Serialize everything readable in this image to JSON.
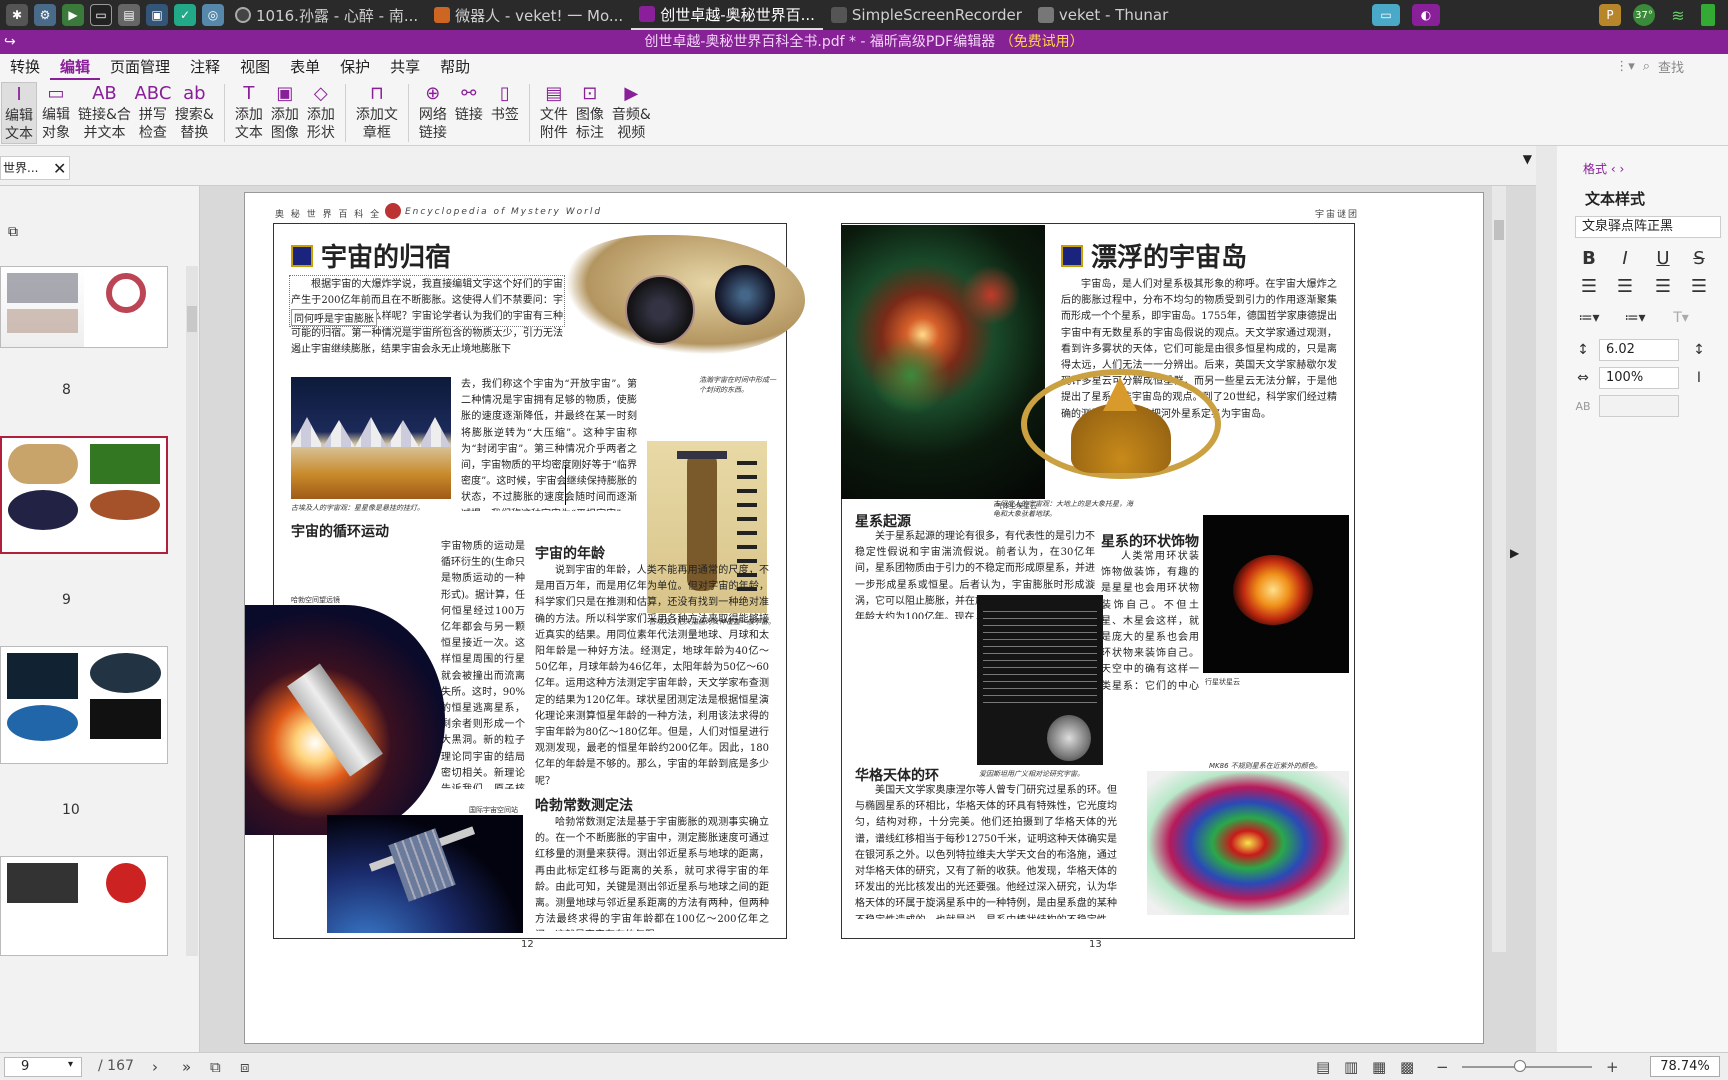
{
  "taskbar": {
    "windows": [
      {
        "label": "1016.孙露 - 心醉 - 南...",
        "active": false
      },
      {
        "label": "微器人 - veket! 一 Mo...",
        "active": false
      },
      {
        "label": "创世卓越-奥秘世界百...",
        "active": true
      },
      {
        "label": "SimpleScreenRecorder",
        "active": false
      },
      {
        "label": "veket - Thunar",
        "active": false
      }
    ],
    "temperature": "37°"
  },
  "titlebar": {
    "title": "创世卓越-奥秘世界百科全书.pdf * - 福昕高级PDF编辑器",
    "trial": "（免费试用）"
  },
  "menu": {
    "items": [
      "转换",
      "编辑",
      "页面管理",
      "注释",
      "视图",
      "表单",
      "保护",
      "共享",
      "帮助"
    ],
    "search_placeholder": "查找"
  },
  "ribbon": {
    "groups": [
      [
        {
          "label": "编辑\n文本",
          "icon": "edit-text-icon",
          "glyph": "I",
          "active": true
        },
        {
          "label": "编辑\n对象",
          "icon": "edit-object-icon",
          "glyph": "▭"
        },
        {
          "label": "链接&合\n并文本",
          "icon": "link-merge-icon",
          "glyph": "AB"
        },
        {
          "label": "拼写\n检查",
          "icon": "spell-check-icon",
          "glyph": "ABC"
        },
        {
          "label": "搜索&\n替换",
          "icon": "search-replace-icon",
          "glyph": "ab"
        }
      ],
      [
        {
          "label": "添加\n文本",
          "icon": "add-text-icon",
          "glyph": "T"
        },
        {
          "label": "添加\n图像",
          "icon": "add-image-icon",
          "glyph": "▣"
        },
        {
          "label": "添加\n形状",
          "icon": "add-shape-icon",
          "glyph": "◇"
        }
      ],
      [
        {
          "label": "添加文\n章框",
          "icon": "article-box-icon",
          "glyph": "⊓"
        }
      ],
      [
        {
          "label": "网络\n链接",
          "icon": "web-link-icon",
          "glyph": "⊕"
        },
        {
          "label": "链接",
          "icon": "link-icon",
          "glyph": "⚯"
        },
        {
          "label": "书签",
          "icon": "bookmark-icon",
          "glyph": "▯"
        }
      ],
      [
        {
          "label": "文件\n附件",
          "icon": "file-attachment-icon",
          "glyph": "▤"
        },
        {
          "label": "图像\n标注",
          "icon": "image-annotation-icon",
          "glyph": "⊡"
        },
        {
          "label": "音频&\n视频",
          "icon": "audio-video-icon",
          "glyph": "▶"
        }
      ]
    ]
  },
  "doctab": {
    "label": "世界..."
  },
  "sidebar": {
    "page_numbers": [
      "8",
      "9",
      "10"
    ]
  },
  "document": {
    "left": {
      "header_cn": "奥 秘 世 界 百 科 全 书",
      "header_en": "Encyclopedia of Mystery World",
      "title": "宇宙的归宿",
      "para1": "根据宇宙的大爆炸学说，我直接编辑文字这个好们的宇宙产生于200亿年前而且在不断膨胀。这使得人们不禁要问：宇宙膨胀的归宿是什么样呢？宇宙论学者认为我们的宇宙有三种可能的归宿。第一种情况是宇宙所包含的物质太少，引力无法遏止宇宙继续膨胀，结果宇宙会永无止境地膨胀下",
      "edit_overlay": "同何呼是宇宙膨胀",
      "para2": "去，我们称这个宇宙为“开放宇宙”。第二种情况是宇宙拥有足够的物质，使膨胀的速度逐渐降低，并最终在某一时刻将膨胀逆转为“大压缩”。这种宇宙称为“封闭宇宙”。第三种情况介乎两者之间，宇宙物质的平均密度刚好等于“临界密度”。这时候，宇宙会继续保持膨胀的状态，不过膨胀的速度会随时间而逐渐减慢。我们称这种宇宙为“平坦宇宙”。",
      "cap_hand": "浩瀚宇宙在时间中形成一个封闭的东西。",
      "cap_mountain": "古埃及人的宇宙观：星星像是悬挂的挂灯。",
      "cap_egypt": "古埃及人把天描画为女神覆盖一般宇宙。",
      "sub_cycle": "宇宙的循环运动",
      "para_cycle": "宇宙物质的运动是循环衍生的(生命只是物质运动的一种形式)。据计算，任何恒星经过100万亿年都会与另一颗恒星接近一次。这样恒星周围的行星就会被撞出而流离失所。这时，90%的恒星逃离星系，剩余者则形成一个大黑洞。新的粒子理论同宇宙的结局密切相关。新理论告诉我们，原子核内的质子可能不是永恒的物质，它的寿命是1亿亿亿亿年。如果真是这样，经过1亿亿亿亿年后，只剩下几种基本粒子和黑洞了。",
      "cap_hubble": "哈勃空间望远镜",
      "cap_station": "国际宇宙空间站",
      "sub_age": "宇宙的年龄",
      "para_age": "说到宇宙的年龄，人类不能再用通常的尺度，不是用百万年，而是用亿年为单位。但对宇宙的年龄，科学家们只是在推测和估算，还没有找到一种绝对准确的方法。所以科学家们采用各种方法来取得能够接近真实的结果。用同位素年代法测量地球、月球和太阳年龄是一种好方法。经测定，地球年龄为40亿～50亿年，月球年龄为46亿年，太阳年龄为50亿～60亿年。运用这种方法测定宇宙年龄，天文学家布查测定的结果为120亿年。球状星团测定法是根据恒星演化理论来测算恒星年龄的一种方法，利用该法求得的宇宙年龄为80亿～180亿年。但是，人们对恒星进行观测发现，最老的恒星年龄约200亿年。因此，180亿年的年龄是不够的。那么，宇宙的年龄到底是多少呢？",
      "sub_hubble": "哈勃常数测定法",
      "para_hubble": "哈勃常数测定法是基于宇宙膨胀的观测事实确立的。在一个不断膨胀的宇宙中，测定膨胀速度可通过红移量的测量来获得。测出邻近星系与地球的距离，再由此标定红移与距离的关系，就可求得宇宙的年龄。由此可知，关键是测出邻近星系与地球之间的距离。测量地球与邻近星系距离的方法有两种，但两种方法最终求得的宇宙年龄都在100亿～200亿年之间，这就是宇宙存在的年限。",
      "page_number": "12"
    },
    "right": {
      "header": "宇宙谜团",
      "title": "漂浮的宇宙岛",
      "para1": "宇宙岛，是人们对星系极其形象的称呼。在宇宙大爆炸之后的膨胀过程中，分布不均匀的物质受到引力的作用逐渐聚集而形成一个个星系，即宇宙岛。1755年，德国哲学家康德提出宇宙中有无数星系的宇宙岛假说的观点。天文学家通过观测，看到许多雾状的天体，它们可能是由很多恒星构成的，只是离得太远，人们无法一一分辨出。后来，英国天文学家赫歇尔发现许多星云可分解成恒星群，而另一些星云无法分解，于是他提出了星系并非宇宙岛的观点。到了20世纪，科学家们经过精确的测量和论证，才把河外星系定名为宇宙岛。",
      "cap_nebula": "气体尘埃星云",
      "cap_turtle": "古印度人的宇宙观：大地上的是大象托星，海龟和大象驮着地球。",
      "sub_origin": "星系起源",
      "para_origin": "关于星系起源的理论有很多，有代表性的是引力不稳定性假说和宇宙湍流假说。前者认为，在30亿年间，星系团物质由于引力的不稳定而形成原星系，并进一步形成星系或恒星。后者认为，宇宙膨胀时形成漩涡，它可以阻止膨胀，并在旋涡处形成原星系。宇宙的年龄大约为100亿年。现在人们观测到的河外星系已达上万个，最远者距银河系达70亿光年。估计河外星系数目大得惊人，若干一个半径达20亿光年的圆球，其内含有约30亿个星系，每个星系都包含着数以千亿计的恒星。",
      "cap_einstein": "爱因斯坦用广义相对论研究宇宙。",
      "sub_ring": "星系的环状饰物",
      "para_ring": "人类常用环状装饰物做装饰，有趣的是星星也会用环状物装饰自己。不但土星、木星会这样，就是庞大的星系也会用环状物来装饰自己。天空中的确有这样一类星系：它们的中心呈恒星状，周围有一个光度均匀、结构对称的环，它们虽有着酷似行星状星云的美丽外表，实质上却是一个星系，用世界上最大的天望远镜可以看见它清晰的清影：核心呈红色，环则有些发蓝。这类天空中的特殊星系又叫“华格天体”。",
      "cap_ringgalaxy": "行星状星云",
      "sub_hoag": "华格天体的环",
      "para_hoag": "美国天文学家奥康涅尔等人曾专门研究过星系的环。但与椭圆星系的环相比，华格天体的环具有特殊性，它光度均匀，结构对称，十分完美。他们还拍摄到了华格天体的光谱，谱线红移相当于每秒12750千米，证明这种天体确实是在银河系之外。以色列特拉维夫大学天文台的布洛施，通过对华格天体的研究，又有了新的收获。他发现，华格天体的环发出的光比核发出的光还要强。他经过深入研究，认为华格天体的环属于旋涡星系中的一种特例，是由星系盘的某种不稳定性造成的，也就是说，星系中棒状结构的不稳定性，搅动星系盘形成了星系的环状结构。",
      "cap_hoagimg": "MK86 不规则星系在近紫外的颜色。",
      "page_number": "13"
    }
  },
  "rightpanel": {
    "tab": "格式",
    "section": "文本样式",
    "font": "文泉驿点阵正黑",
    "font_size": "6.02",
    "scale": "100%"
  },
  "statusbar": {
    "page": "9",
    "total": "/ 167",
    "zoom": "78.74%"
  }
}
